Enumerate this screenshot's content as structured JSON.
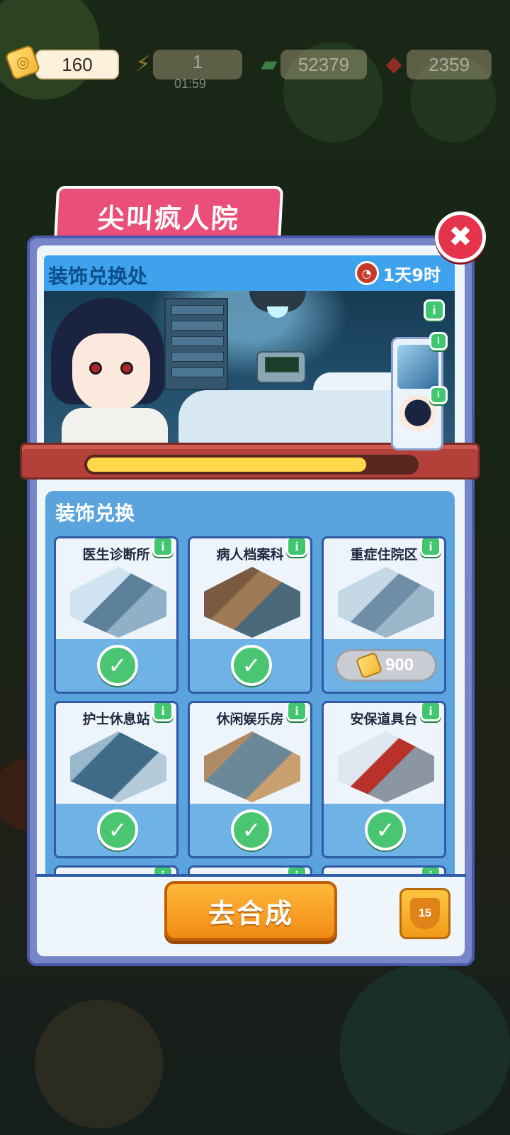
{
  "currencies": {
    "tickets": "160",
    "energy": "1",
    "energy_timer": "01:59",
    "cash": "52379",
    "gems": "2359"
  },
  "icons": {
    "ticket": "ticket-icon",
    "energy": "lightning-icon",
    "cash": "cash-icon",
    "gem": "ruby-icon",
    "close": "close-icon",
    "clock": "clock-icon",
    "info": "info-icon",
    "check": "check-icon",
    "trophy": "trophy-icon"
  },
  "panel": {
    "title": "尖叫疯人院",
    "close_label": "✖"
  },
  "shop": {
    "title": "装饰兑换处",
    "time_left": "1天9时",
    "progress": 0.85
  },
  "exchange": {
    "title": "装饰兑换",
    "items": [
      {
        "name": "医生诊断所",
        "status": "owned"
      },
      {
        "name": "病人档案科",
        "status": "owned"
      },
      {
        "name": "重症住院区",
        "status": "locked",
        "price": "900"
      },
      {
        "name": "护士休息站",
        "status": "owned"
      },
      {
        "name": "休闲娱乐房",
        "status": "owned"
      },
      {
        "name": "安保道具台",
        "status": "owned"
      }
    ]
  },
  "actions": {
    "go_merge": "去合成",
    "trophy_level": "15"
  },
  "colors": {
    "title_tab": "#ea4f79",
    "close_button": "#e5334b",
    "shop_header": "#3fa2ec",
    "progress_fill": "#ffd84a",
    "owned_check": "#4ac672",
    "go_button": "#f08a12"
  }
}
